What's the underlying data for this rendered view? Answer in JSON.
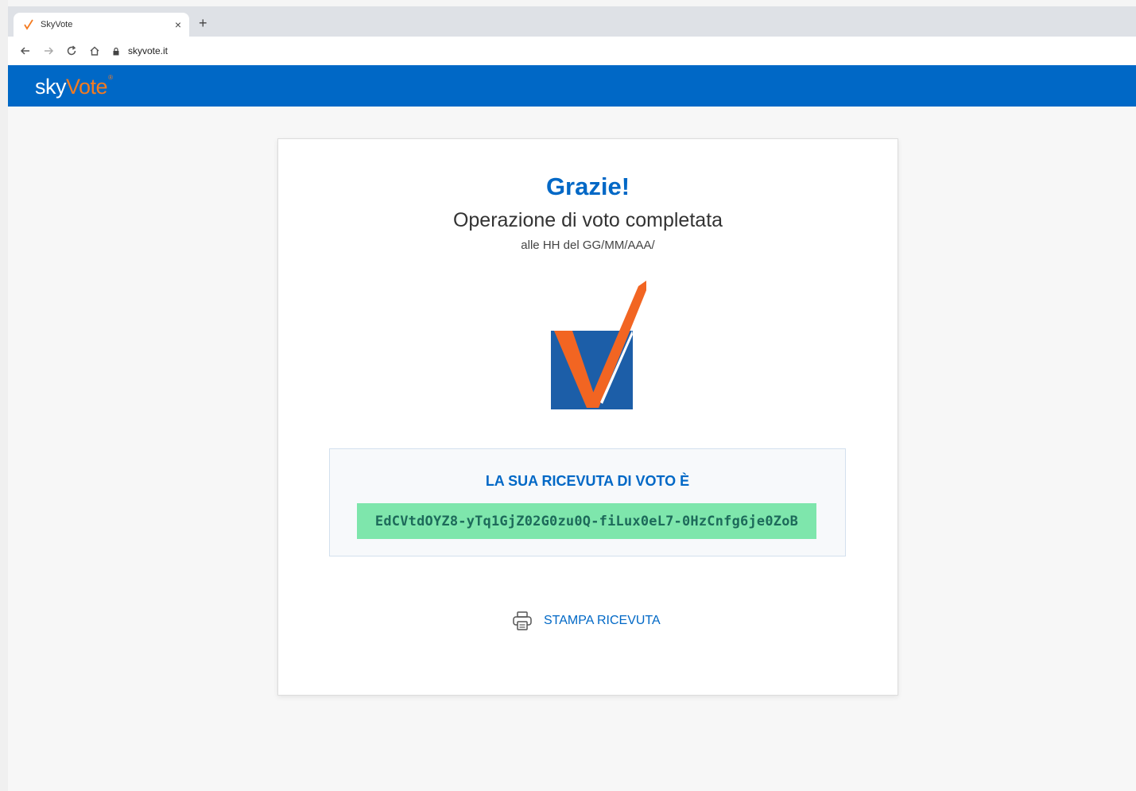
{
  "browser": {
    "tab_title": "SkyVote",
    "tab_close": "×",
    "new_tab": "+",
    "url": "skyvote.it"
  },
  "header": {
    "logo_sky": "sky",
    "logo_vote": "Vote",
    "logo_tm": "®",
    "brand_color": "#0068c6",
    "accent_color": "#f47b20"
  },
  "confirmation": {
    "title": "Grazie!",
    "subtitle": "Operazione di voto completata",
    "timestamp": "alle HH del GG/MM/AAA/",
    "icon": "vote-checkmark-logo"
  },
  "receipt": {
    "label": "LA SUA RICEVUTA DI VOTO È",
    "code": "EdCVtdOYZ8-yTq1GjZ02G0zu0Q-fiLux0eL7-0HzCnfg6je0ZoB",
    "code_bg_color": "#7ee6ac"
  },
  "actions": {
    "print_label": "STAMPA RICEVUTA",
    "print_icon": "printer-icon"
  }
}
